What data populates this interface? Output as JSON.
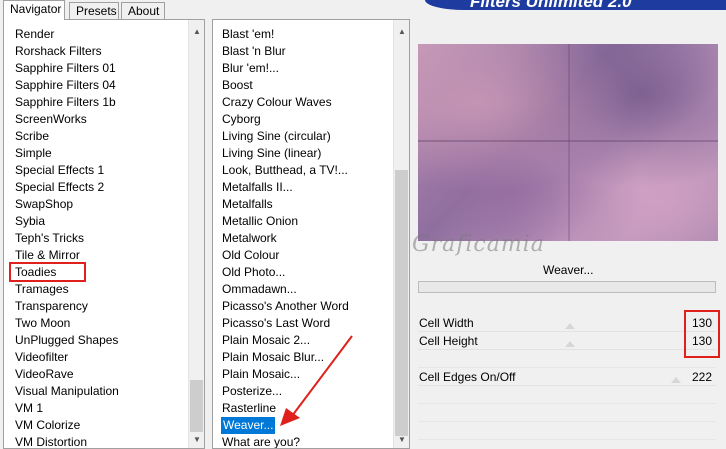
{
  "tabs": [
    {
      "label": "Navigator"
    },
    {
      "label": "Presets"
    },
    {
      "label": "About"
    }
  ],
  "banner": {
    "title": "Filters Unlimited 2.0"
  },
  "categories": [
    "Render",
    "Rorshack Filters",
    "Sapphire Filters 01",
    "Sapphire Filters 04",
    "Sapphire Filters 1b",
    "ScreenWorks",
    "Scribe",
    "Simple",
    "Special Effects 1",
    "Special Effects 2",
    "SwapShop",
    "Sybia",
    "Teph's Tricks",
    "Tile & Mirror",
    "Toadies",
    "Tramages",
    "Transparency",
    "Two Moon",
    "UnPlugged Shapes",
    "Videofilter",
    "VideoRave",
    "Visual Manipulation",
    "VM 1",
    "VM Colorize",
    "VM Distortion"
  ],
  "filters": [
    "Blast 'em!",
    "Blast 'n Blur",
    "Blur 'em!...",
    "Boost",
    "Crazy Colour Waves",
    "Cyborg",
    "Living Sine (circular)",
    "Living Sine (linear)",
    "Look, Butthead, a TV!...",
    "Metalfalls II...",
    "Metalfalls",
    "Metallic Onion",
    "Metalwork",
    "Old Colour",
    "Old Photo...",
    "Ommadawn...",
    "Picasso's Another Word",
    "Picasso's Last Word",
    "Plain Mosaic 2...",
    "Plain Mosaic Blur...",
    "Plain Mosaic...",
    "Posterize...",
    "Rasterline",
    "Weaver...",
    "What are you?"
  ],
  "selected_category": "Toadies",
  "selected_filter": "Weaver...",
  "watermark": "Graficamia",
  "preview_filter_name": "Weaver...",
  "params": {
    "cell_width": {
      "label": "Cell Width",
      "value": "130",
      "level": 0.51
    },
    "cell_height": {
      "label": "Cell Height",
      "value": "130",
      "level": 0.51
    },
    "cell_edges": {
      "label": "Cell Edges On/Off",
      "value": "222",
      "level": 0.87
    }
  },
  "colors": {
    "selection": "#0078d7",
    "annotation_red": "#e0201a",
    "banner_blue": "#1e3ca0"
  }
}
